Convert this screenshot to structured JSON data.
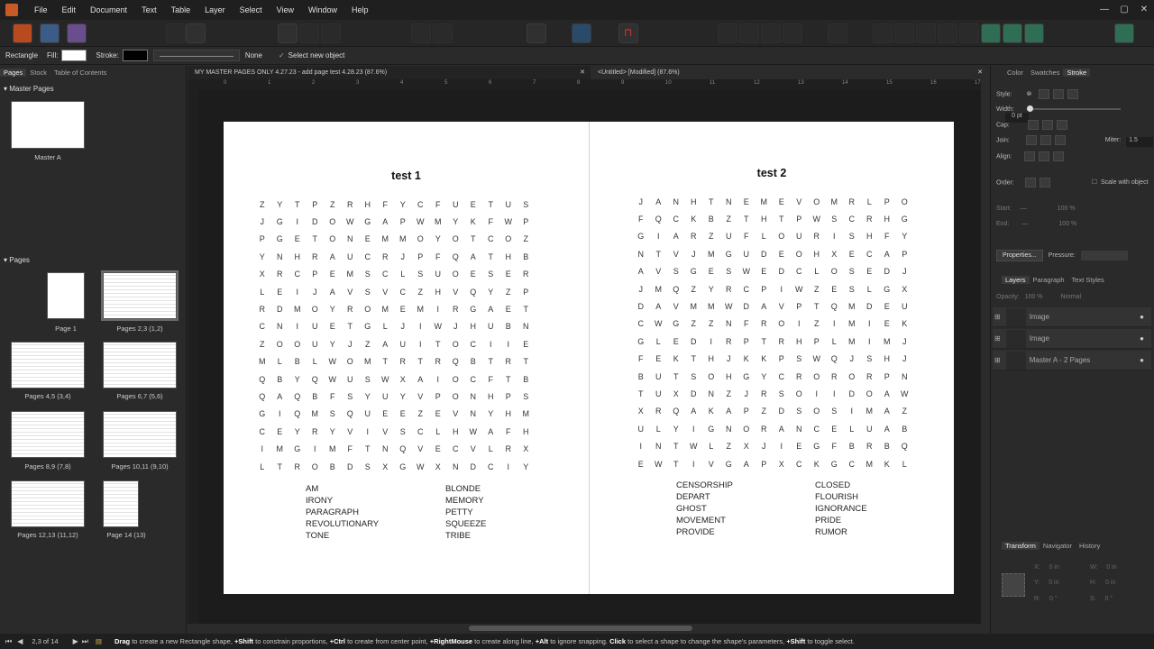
{
  "menu": [
    "File",
    "Edit",
    "Document",
    "Text",
    "Table",
    "Layer",
    "Select",
    "View",
    "Window",
    "Help"
  ],
  "context": {
    "tool": "Rectangle",
    "fill_label": "Fill:",
    "stroke_label": "Stroke:",
    "stroke_style": "None",
    "select_new": "Select new object"
  },
  "left": {
    "tabs": [
      "Pages",
      "Stock",
      "Table of Contents"
    ],
    "master_header": "Master Pages",
    "master_item": "Master A",
    "pages_header": "Pages",
    "pages": [
      "Page 1",
      "Pages 2,3 (1,2)",
      "Pages 4,5 (3,4)",
      "Pages 6,7 (5,6)",
      "Pages 8,9 (7,8)",
      "Pages 10,11 (9,10)",
      "Pages 12,13 (11,12)",
      "Page 14 (13)"
    ]
  },
  "doctabs": [
    "MY MASTER PAGES ONLY 4.27.23 - add page test 4.28.23 (87.6%)",
    "<Untitled> [Modified] (87.6%)"
  ],
  "ruler": [
    "0",
    "1",
    "2",
    "3",
    "4",
    "5",
    "6",
    "7",
    "8",
    "9",
    "10",
    "11",
    "12",
    "13",
    "14",
    "15",
    "16",
    "17"
  ],
  "puzzle1": {
    "title": "test 1",
    "grid": [
      "ZYTPZRHFYCFUETUS",
      "JGIDOWGAPWMYKFWP",
      "PGETONEMMOYOTCOZ",
      "YNHRAUCRJPFQATHB",
      "XRCPEMSCLSUOESER",
      "LEIJAVSVCZHVQYZP",
      "RDMOYROMEMIRGAET",
      "CNIUETGLJIWJHUBN",
      "ZOOUYJZAUITOCIIE",
      "MLBLWOMTRTRQBTRT",
      "QBYQWUSWXAIOCFTB",
      "QAQBFSYUYVPONHPS",
      "GIQMSQUEEZEVNYHM",
      "CEYRYVIVSCLHWAFH",
      "IMGIMFTNQVECVLRX",
      "LTROBDSXGWXNDCIY"
    ],
    "words_left": [
      "AM",
      "IRONY",
      "PARAGRAPH",
      "REVOLUTIONARY",
      "TONE"
    ],
    "words_right": [
      "BLONDE",
      "MEMORY",
      "PETTY",
      "SQUEEZE",
      "TRIBE"
    ]
  },
  "puzzle2": {
    "title": "test 2",
    "grid": [
      "JANHTNEMEVOMRLPO",
      "FQCKBZTHTPWSCRHG",
      "GIARZUFLOURISHFY",
      "NTVJMGUDEOHXECAP",
      "AVSGESWEDCLOSEDJ",
      "JMQZYRCPIWZESLGX",
      "DAVMMWDAVPTQMDEU",
      "CWGZZNFROIZIMIEK",
      "GLEDIRPTRHPLMIMJ",
      "FEKTHJKKPSWQJSHJ",
      "BUTSOHGYCRORORPN",
      "TUXDNZJRSOIIDOAW",
      "XRQAKAPZDSOSIMAZ",
      "ULYIGNORANCELUAB",
      "INTWLZXJIEGFBRBQ",
      "EWTIVGAPXCKGCMKL"
    ],
    "words_left": [
      "CENSORSHIP",
      "DEPART",
      "GHOST",
      "MOVEMENT",
      "PROVIDE"
    ],
    "words_right": [
      "CLOSED",
      "FLOURISH",
      "IGNORANCE",
      "PRIDE",
      "RUMOR"
    ]
  },
  "right": {
    "tabs": [
      "Color",
      "Swatches",
      "Stroke"
    ],
    "style_label": "Style:",
    "width_label": "Width:",
    "width_value": "0 pt",
    "cap_label": "Cap:",
    "join_label": "Join:",
    "miter_label": "Miter:",
    "miter_value": "1.5",
    "align_label": "Align:",
    "order_label": "Order:",
    "scale_label": "Scale with object",
    "start_label": "Start:",
    "end_label": "End:",
    "start_pct": "100 %",
    "end_pct": "100 %",
    "properties_btn": "Properties...",
    "pressure_label": "Pressure:",
    "layer_tabs": [
      "Layers",
      "Paragraph",
      "Text Styles"
    ],
    "opacity_label": "Opacity:",
    "opacity_value": "100 %",
    "blend_mode": "Normal",
    "layers": [
      "Image",
      "Image",
      "Master A - 2 Pages"
    ],
    "bottom_tabs": [
      "Transform",
      "Navigator",
      "History"
    ],
    "transform": {
      "x": "0 in",
      "y": "0 in",
      "w": "0 in",
      "h": "0 in",
      "r": "0 °",
      "s": "0 °"
    }
  },
  "status": {
    "page_indicator": "2,3 of 14",
    "hint_parts": [
      {
        "b": "Drag",
        "t": " to create a new Rectangle shape, "
      },
      {
        "b": "+Shift",
        "t": " to constrain proportions, "
      },
      {
        "b": "+Ctrl",
        "t": " to create from center point, "
      },
      {
        "b": "+RightMouse",
        "t": " to create along line, "
      },
      {
        "b": "+Alt",
        "t": " to ignore snapping. "
      },
      {
        "b": "Click",
        "t": " to select a shape to change the shape's parameters, "
      },
      {
        "b": "+Shift",
        "t": " to toggle select."
      }
    ]
  }
}
